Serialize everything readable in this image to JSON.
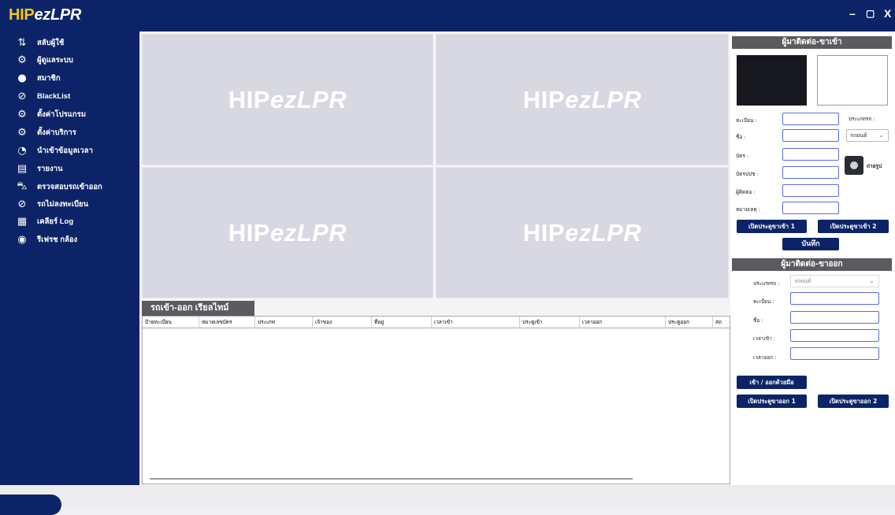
{
  "window": {
    "logo_prefix": "HIP",
    "logo_suffix": "ezLPR",
    "minimize": "–",
    "restore": "▢",
    "close": "X"
  },
  "sidebar": {
    "items": [
      {
        "label": "สลับผู้ใช้",
        "icon": "switch-user-icon",
        "glyph": "⇅"
      },
      {
        "label": "ผู้ดูแลระบบ",
        "icon": "admin-gear-icon",
        "glyph": "⚙"
      },
      {
        "label": "สมาชิก",
        "icon": "member-icon",
        "glyph": "●"
      },
      {
        "label": "BlackList",
        "icon": "blacklist-icon",
        "glyph": "⊘"
      },
      {
        "label": "ตั้งค่าโปรแกรม",
        "icon": "program-settings-icon",
        "glyph": "⚙"
      },
      {
        "label": "ตั้งค่าบริการ",
        "icon": "service-settings-icon",
        "glyph": "⚙"
      },
      {
        "label": "นำเข้าข้อมูลเวลา",
        "icon": "import-time-icon",
        "glyph": "◔"
      },
      {
        "label": "รายงาน",
        "icon": "report-icon",
        "glyph": "▤"
      },
      {
        "label": "ตรวจสอบรถเข้าออก",
        "icon": "car-check-icon",
        "glyph": "⛍"
      },
      {
        "label": "รถไม่ลงทะเบียน",
        "icon": "unregistered-car-icon",
        "glyph": "⊘"
      },
      {
        "label": "เคลียร์ Log",
        "icon": "clear-log-icon",
        "glyph": "▦"
      },
      {
        "label": "รีเฟรช กล้อง",
        "icon": "refresh-camera-icon",
        "glyph": "◉"
      }
    ]
  },
  "cameras": {
    "watermark_prefix": "HIP",
    "watermark_suffix": "ezLPR"
  },
  "grid": {
    "tab_label": "รถเข้า-ออก เรียลไทม์",
    "columns": [
      "ป้ายทะเบียน",
      "หมายเลขบัตร",
      "ประเภท",
      "เจ้าของ",
      "ที่อยู่",
      "เวลาเข้า",
      "ประตูเข้า",
      "เวลาออก",
      "ประตูออก",
      "สถ"
    ]
  },
  "entry_panel": {
    "title": "ผู้มาติดต่อ-ขาเข้า",
    "plate_label": "ทะเบียน :",
    "car_type_label": "ประเภทรถ :",
    "name_label": "ชื่อ :",
    "car_type_value": "รถยนต์",
    "card_label": "บัตร :",
    "id_card_label": "บัตรปปช :",
    "contact_label": "ผู้ติดต่อ :",
    "note_label": "หมายเหตุ :",
    "photo_label": "ถ่ายรูป",
    "open_gate_in_1": "เปิดประตูขาเข้า 1",
    "open_gate_in_2": "เปิดประตูขาเข้า 2",
    "save": "บันทึก"
  },
  "exit_panel": {
    "title": "ผู้มาติดต่อ-ขาออก",
    "car_type_label": "ประเภทรถ :",
    "car_type_value": "รถยนต์",
    "plate_label": "ทะเบียน :",
    "name_label": "ชื่อ :",
    "time_in_label": "เวลาเข้า :",
    "time_out_label": "เวลาออก :",
    "manual_in_out": "เข้า / ออกด้วยมือ",
    "open_gate_out_1": "เปิดประตูขาออก 1",
    "open_gate_out_2": "เปิดประตูขาออก 2"
  },
  "colors": {
    "navy": "#0c2467",
    "header_gray": "#5b5b5f",
    "camera_bg": "#d8d8e2",
    "logo_yellow": "#f5c518"
  }
}
